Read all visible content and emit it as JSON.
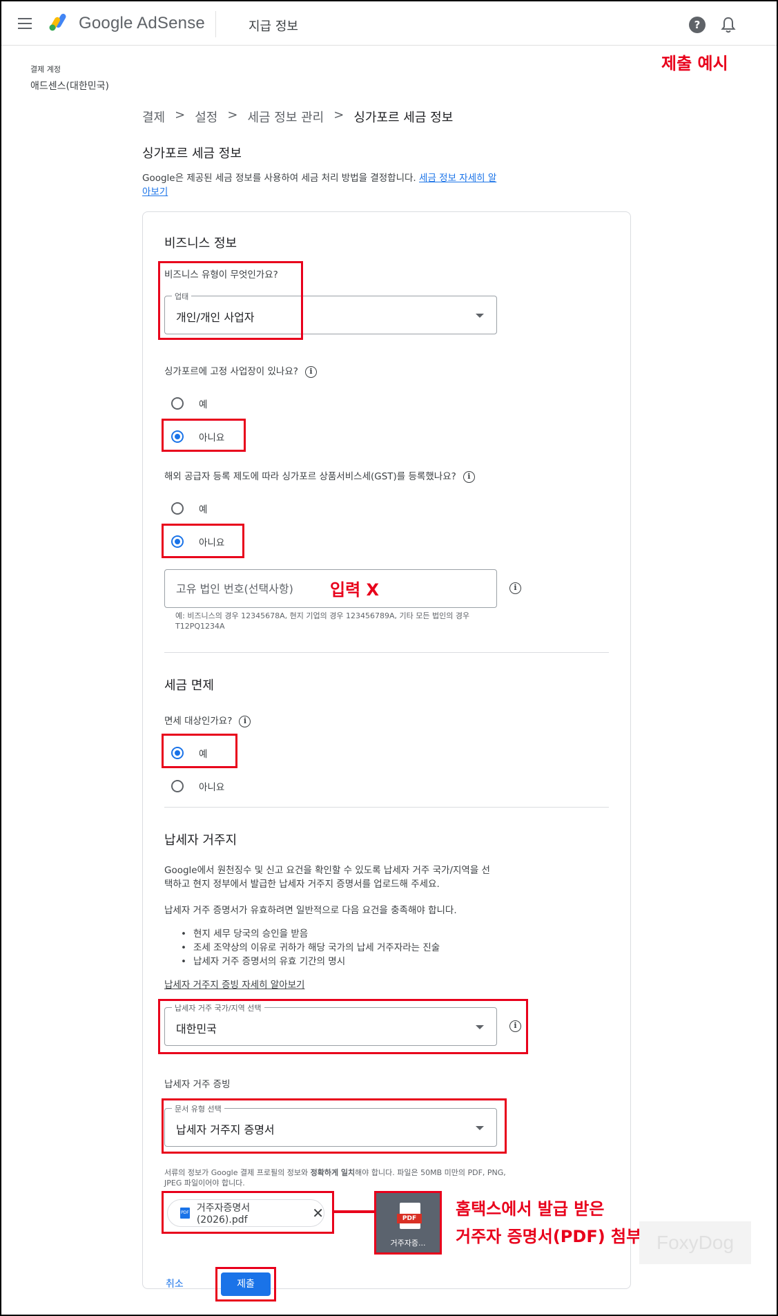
{
  "header": {
    "menu_icon": "hamburger-menu-icon",
    "brand": "Google AdSense",
    "page_title": "지급 정보",
    "help_icon": "help-icon",
    "help_glyph": "?",
    "bell_icon": "notifications-bell-icon"
  },
  "account": {
    "label": "결제 계정",
    "name": "애드센스(대한민국)"
  },
  "annotations": {
    "title": "제출 예시",
    "no_input": "입력 X",
    "attach_note_1": "홈택스에서 발급 받은",
    "attach_note_2": "거주자 증명서(PDF) 첨부",
    "color": "#e8001b"
  },
  "breadcrumb": {
    "items": [
      "결제",
      "설정",
      "세금 정보 관리",
      "싱가포르 세금 정보"
    ],
    "separator": ">"
  },
  "page": {
    "heading": "싱가포르 세금 정보",
    "intro": "Google은 제공된 세금 정보를 사용하여 세금 처리 방법을 결정합니다.",
    "intro_link": "세금 정보 자세히 알아보기"
  },
  "business": {
    "title": "비즈니스 정보",
    "type_question": "비즈니스 유형이 무엇인가요?",
    "type_label": "업태",
    "type_value": "개인/개인 사업자",
    "fixed_place_question": "싱가포르에 고정 사업장이 있나요?",
    "fixed_yes": "예",
    "fixed_no": "아니요",
    "fixed_selected": "아니요",
    "gst_question": "해외 공급자 등록 제도에 따라 싱가포르 상품서비스세(GST)를 등록했나요?",
    "gst_yes": "예",
    "gst_no": "아니요",
    "gst_selected": "아니요",
    "uen_placeholder": "고유 법인 번호(선택사항)",
    "uen_helper": "예: 비즈니스의 경우 12345678A, 현지 기업의 경우 123456789A, 기타 모든 법인의 경우 T12PQ1234A"
  },
  "exemption": {
    "title": "세금 면제",
    "question": "면세 대상인가요?",
    "yes": "예",
    "no": "아니요",
    "selected": "예"
  },
  "residency": {
    "title": "납세자 거주지",
    "desc": "Google에서 원천징수 및 신고 요건을 확인할 수 있도록 납세자 거주 국가/지역을 선택하고 현지 정부에서 발급한 납세자 거주지 증명서를 업로드해 주세요.",
    "requirements_intro": "납세자 거주 증명서가 유효하려면 일반적으로 다음 요건을 충족해야 합니다.",
    "requirements": [
      "현지 세무 당국의 승인을 받음",
      "조세 조약상의 이유로 귀하가 해당 국가의 납세 거주자라는 진술",
      "납세자 거주 증명서의 유효 기간의 명시"
    ],
    "learn_more": "납세자 거주지 증빙 자세히 알아보기",
    "country_label": "납세자 거주 국가/지역 선택",
    "country_value": "대한민국",
    "proof_title": "납세자 거주 증빙",
    "doc_label": "문서 유형 선택",
    "doc_value": "납세자 거주지 증명서",
    "file_note_a": "서류의 정보가 Google 결제 프로필의 정보와 ",
    "file_note_bold": "정확하게 일치",
    "file_note_b": "해야 합니다. 파일은 50MB 미만의 PDF, PNG, JPEG 파일이어야 합니다.",
    "file_name": "거주자증명서(2026).pdf",
    "file_icon": "pdf-file-icon",
    "file_icon_text": "PDF",
    "remove_icon": "close-icon",
    "thumb_label": "PDF",
    "thumb_caption": "거주자증..."
  },
  "actions": {
    "cancel": "취소",
    "submit": "제출"
  },
  "watermark": "FoxyDog"
}
